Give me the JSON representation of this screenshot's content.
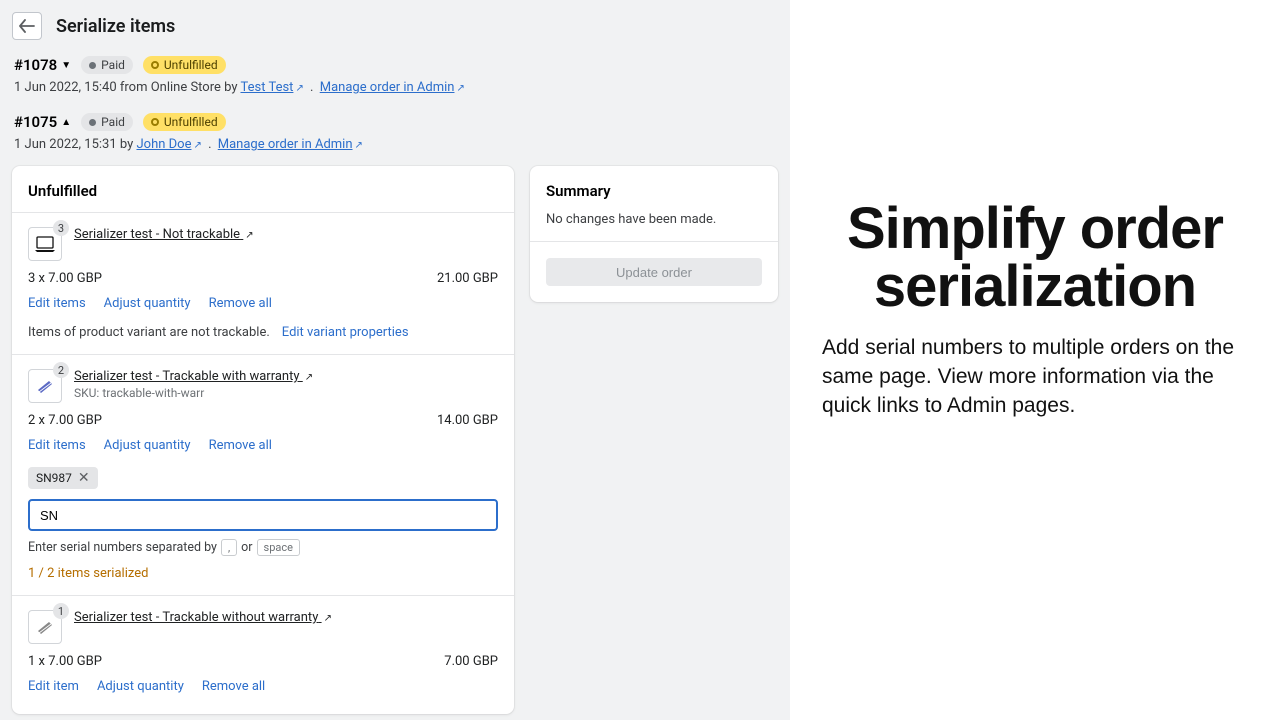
{
  "header": {
    "title": "Serialize items"
  },
  "orders": {
    "first": {
      "number": "#1078",
      "paid": "Paid",
      "fulfill": "Unfulfilled",
      "meta_prefix": "1 Jun 2022, 15:40 from Online Store by ",
      "author": "Test Test",
      "manage": "Manage order in Admin"
    },
    "second": {
      "number": "#1075",
      "paid": "Paid",
      "fulfill": "Unfulfilled",
      "meta_prefix": "1 Jun 2022, 15:31 by ",
      "author": "John Doe",
      "manage": "Manage order in Admin"
    }
  },
  "section": {
    "unfulfilled": "Unfulfilled",
    "summary": "Summary",
    "summary_text": "No changes have been made.",
    "update_btn": "Update order"
  },
  "items": {
    "a": {
      "qty_badge": "3",
      "name": "Serializer test - Not trackable",
      "price_line": "3 x 7.00 GBP",
      "price_total": "21.00 GBP",
      "edit": "Edit items",
      "adjust": "Adjust quantity",
      "remove": "Remove all",
      "untrack_note": "Items of product variant are not trackable.",
      "edit_variant": "Edit variant properties"
    },
    "b": {
      "qty_badge": "2",
      "name": "Serializer test - Trackable with warranty",
      "sku": "SKU: trackable-with-warr",
      "price_line": "2 x 7.00 GBP",
      "price_total": "14.00 GBP",
      "edit": "Edit items",
      "adjust": "Adjust quantity",
      "remove": "Remove all",
      "tag": "SN987",
      "input_value": "SN",
      "hint_pre": "Enter serial numbers separated by",
      "hint_comma": ",",
      "hint_or": "or",
      "hint_space": "space",
      "warn": "1 / 2 items serialized"
    },
    "c": {
      "qty_badge": "1",
      "name": "Serializer test - Trackable without warranty",
      "price_line": "1 x 7.00 GBP",
      "price_total": "7.00 GBP",
      "edit": "Edit item",
      "adjust": "Adjust quantity",
      "remove": "Remove all"
    }
  },
  "promo": {
    "title_l1": "Simplify order",
    "title_l2": "serialization",
    "sub": "Add serial numbers to multiple orders on the same page. View more information via the quick links to Admin pages."
  }
}
